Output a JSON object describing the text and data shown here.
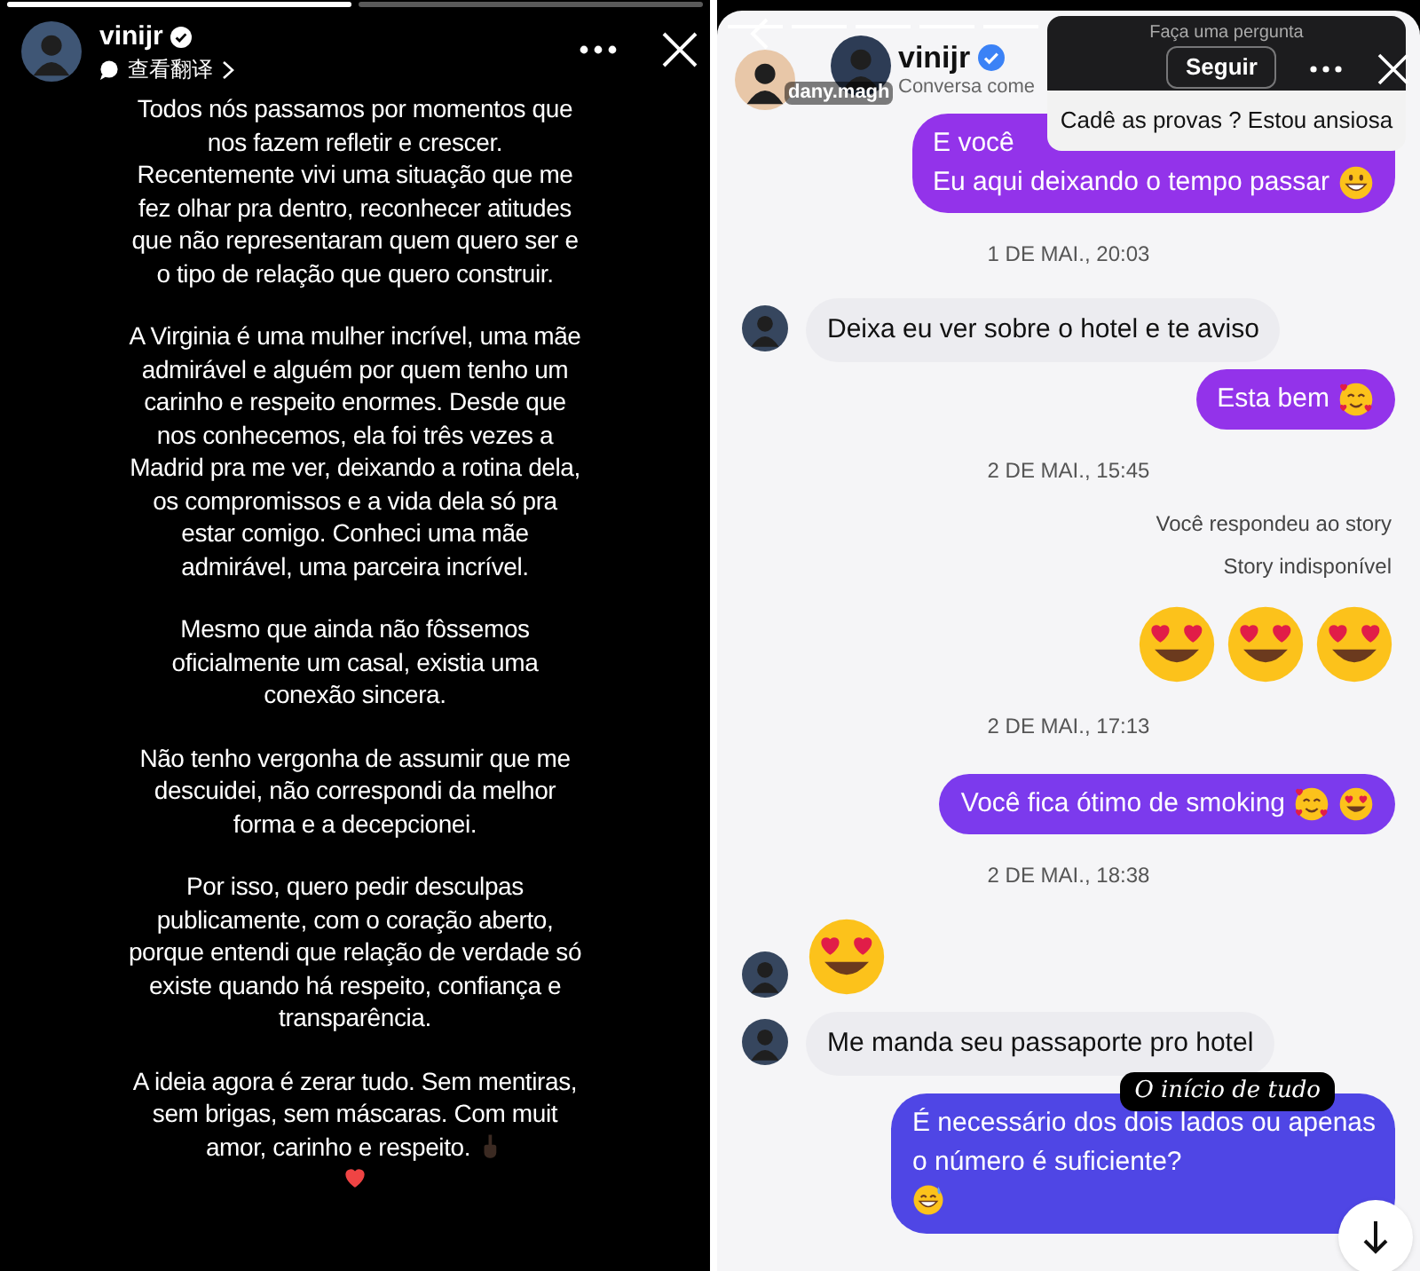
{
  "left_story": {
    "progress": [
      {
        "level": 1
      },
      {
        "level": 0
      }
    ],
    "header": {
      "username": "vinijr",
      "translate": "查看翻译"
    },
    "paragraphs": [
      {
        "text": "Todos nós passamos por momentos que nos fazem refletir e crescer. Recentemente vivi uma situação que me fez olhar pra dentro, reconhecer atitudes que não representaram quem quero ser e o tipo de relação que quero construir."
      },
      {
        "text": "A Virginia é uma mulher incrível, uma mãe admirável e alguém por quem tenho um carinho e respeito enormes. Desde que nos conhecemos, ela foi três vezes a Madrid pra me ver, deixando a rotina dela, os compromissos e a vida dela só pra estar comigo. Conheci uma mãe admirável, uma parceira incrível."
      },
      {
        "text": "Mesmo que ainda não fôssemos oficialmente um casal, existia uma conexão sincera."
      },
      {
        "text": "Não tenho vergonha de assumir que me descuidei, não correspondi  da melhor forma e a decepcionei."
      },
      {
        "text": "Por isso, quero pedir desculpas publicamente, com o coração aberto, porque entendi que relação de verdade só existe quando há respeito, confiança e transparência."
      },
      {
        "text": "A ideia agora é zerar tudo. Sem mentiras, sem brigas, sem máscaras. Com muit amor, carinho e respeito.",
        "emojis": [
          {
            "kind": "hand"
          }
        ]
      }
    ],
    "closing_emojis": [
      {
        "kind": "heart"
      }
    ]
  },
  "right_story": {
    "header": {
      "viewer": "dany.magh",
      "username": "vinijr",
      "subtitle": "Conversa come"
    },
    "question_sticker": {
      "prompt": "Faça uma pergunta",
      "answer": "Cadê as provas ? Estou ansiosa"
    },
    "follow_button": "Seguir",
    "messages": [
      {
        "kind": "sent",
        "lines": [
          "E você",
          "Eu aqui deixando o tempo passar"
        ],
        "emojis": [
          {
            "kind": "grin"
          }
        ],
        "color": "#9333ea"
      },
      {
        "kind": "date",
        "text": "1 DE MAI., 20:03"
      },
      {
        "kind": "received",
        "lines": [
          "Deixa eu ver sobre o hotel e te aviso"
        ]
      },
      {
        "kind": "sent",
        "lines": [
          "Esta bem"
        ],
        "emojis": [
          {
            "kind": "hearts"
          }
        ],
        "color": "#9333ea"
      },
      {
        "kind": "date",
        "text": "2 DE MAI., 15:45"
      },
      {
        "kind": "story_reply",
        "lines": [
          "Você respondeu ao story",
          "Story indisponível"
        ]
      },
      {
        "kind": "big_emoji",
        "emojis": [
          {
            "kind": "heart_eyes"
          },
          {
            "kind": "heart_eyes"
          },
          {
            "kind": "heart_eyes"
          }
        ]
      },
      {
        "kind": "date",
        "text": "2 DE MAI., 17:13"
      },
      {
        "kind": "sent",
        "lines": [
          "Você fica ótimo de smoking"
        ],
        "emojis": [
          {
            "kind": "hearts"
          },
          {
            "kind": "heart_eyes"
          }
        ],
        "color": "#7c3aed"
      },
      {
        "kind": "date",
        "text": "2 DE MAI., 18:38"
      },
      {
        "kind": "received_emoji",
        "emojis": [
          {
            "kind": "heart_eyes"
          }
        ]
      },
      {
        "kind": "received",
        "lines": [
          "Me manda seu passaporte pro hotel"
        ]
      },
      {
        "kind": "sent",
        "caption": "O início de tudo",
        "lines": [
          "É necessário dos dois lados ou apenas",
          "o número é suficiente?"
        ],
        "emojis": [
          {
            "kind": "sweat"
          }
        ],
        "color": "#4f46e5"
      }
    ]
  }
}
